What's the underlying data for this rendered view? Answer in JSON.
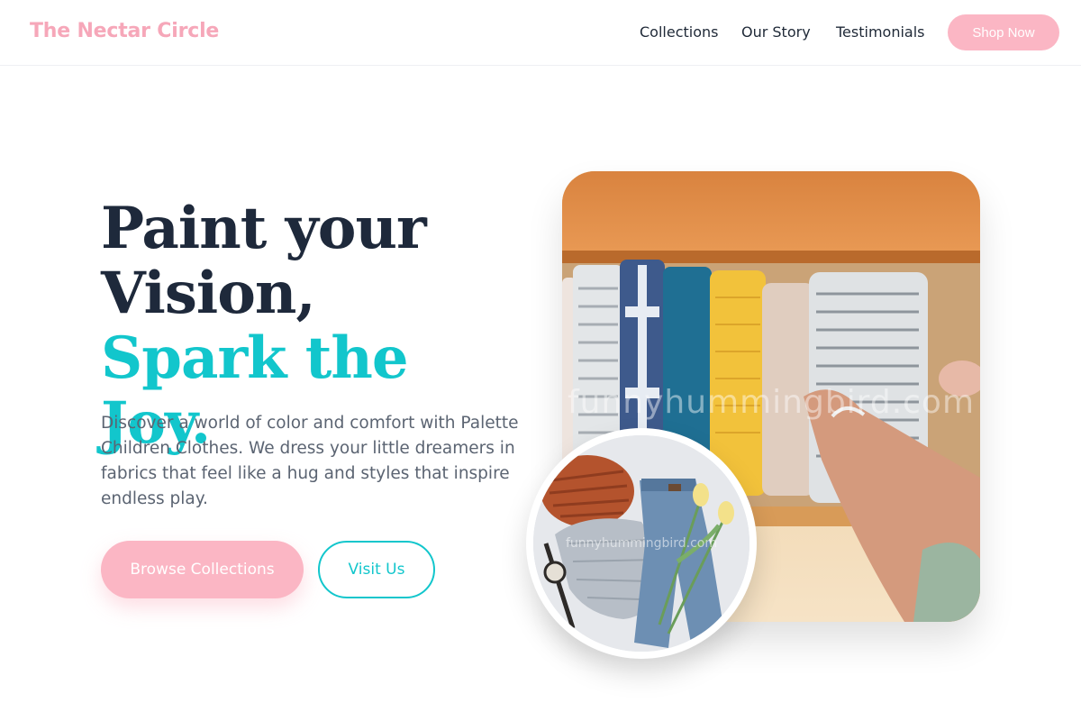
{
  "header": {
    "logo": "The Nectar Circle",
    "nav": [
      "Collections",
      "Our Story",
      "Testimonials"
    ],
    "cta": "Shop Now"
  },
  "hero": {
    "title_line1": "Paint your",
    "title_line2": "Vision,",
    "title_accent": "Spark the Joy.",
    "description": "Discover a world of color and comfort with Palette Children Clothes. We dress your little dreamers in fabrics that feel like a hug and styles that inspire endless play.",
    "primary_button": "Browse Collections",
    "secondary_button": "Visit Us"
  },
  "images": {
    "main_watermark": "funnyhummingbird.com",
    "circle_watermark": "funnyhummingbird.com"
  },
  "colors": {
    "brand_pink": "#fbb6c4",
    "accent_teal": "#12c6cc",
    "heading": "#1e293b"
  }
}
